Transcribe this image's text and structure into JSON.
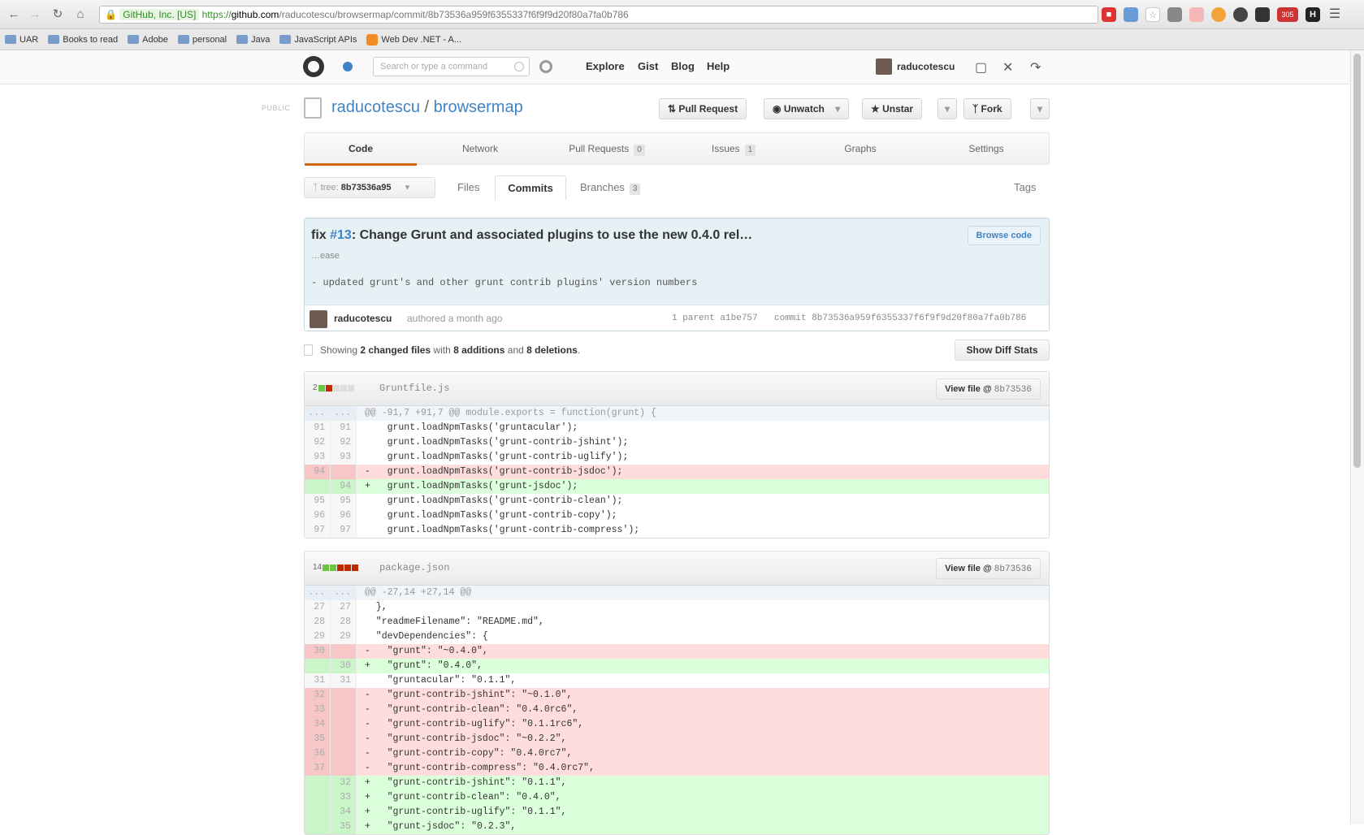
{
  "browser": {
    "address": {
      "org_label": "GitHub, Inc. [US]",
      "scheme": "https://",
      "host": "github.com",
      "path": "/raducotescu/browsermap/commit/8b73536a959f6355337f6f9f9d20f80a7fa0b786"
    },
    "bookmarks": [
      "UAR",
      "Books to read",
      "Adobe",
      "personal",
      "Java",
      "JavaScript APIs",
      "Web Dev .NET - A..."
    ],
    "ext_badge": "305"
  },
  "header": {
    "search_placeholder": "Search or type a command",
    "nav": [
      "Explore",
      "Gist",
      "Blog",
      "Help"
    ],
    "username": "raducotescu"
  },
  "repo": {
    "public_label": "PUBLIC",
    "owner": "raducotescu",
    "separator": "/",
    "name": "browsermap",
    "buttons": {
      "pull_request": "Pull Request",
      "unwatch": "Unwatch",
      "unstar": "Unstar",
      "fork": "Fork"
    }
  },
  "tabs": {
    "code": "Code",
    "network": "Network",
    "pull_requests": "Pull Requests",
    "pull_requests_count": "0",
    "issues": "Issues",
    "issues_count": "1",
    "graphs": "Graphs",
    "settings": "Settings"
  },
  "subnav": {
    "branch_prefix": "tree:",
    "branch": "8b73536a95",
    "files": "Files",
    "commits": "Commits",
    "branches": "Branches",
    "branches_count": "3",
    "tags": "Tags"
  },
  "commit": {
    "title_prefix": "fix ",
    "issue_ref": "#13",
    "title_rest": ": Change Grunt and associated plugins to use the new 0.4.0 rel…",
    "ellipsis": "…ease",
    "description": "- updated grunt's and other grunt contrib plugins' version numbers",
    "browse_code": "Browse code",
    "author": "raducotescu",
    "authored": "authored a month ago",
    "parent_info": "1 parent a1be757",
    "sha_line": "commit 8b73536a959f6355337f6f9f9d20f80a7fa0b786"
  },
  "toc": {
    "showing": "Showing ",
    "changed": "2 changed files",
    "with": " with ",
    "additions": "8 additions",
    "and": " and ",
    "deletions": "8 deletions",
    "end": ".",
    "diff_stats_btn": "Show Diff Stats"
  },
  "files": [
    {
      "name": "Gruntfile.js",
      "stat_count": "2",
      "view_label": "View file @",
      "view_sha": "8b73536",
      "rows": [
        {
          "type": "hunk",
          "old": "...",
          "new": "...",
          "text": "@@ -91,7 +91,7 @@ module.exports = function(grunt) {"
        },
        {
          "type": "ctx",
          "old": "91",
          "new": "91",
          "text": "    grunt.loadNpmTasks('gruntacular');"
        },
        {
          "type": "ctx",
          "old": "92",
          "new": "92",
          "text": "    grunt.loadNpmTasks('grunt-contrib-jshint');"
        },
        {
          "type": "ctx",
          "old": "93",
          "new": "93",
          "text": "    grunt.loadNpmTasks('grunt-contrib-uglify');"
        },
        {
          "type": "del",
          "old": "94",
          "new": "",
          "text": "-   grunt.loadNpmTasks('grunt-contrib-jsdoc');"
        },
        {
          "type": "add",
          "old": "",
          "new": "94",
          "text": "+   grunt.loadNpmTasks('grunt-jsdoc');"
        },
        {
          "type": "ctx",
          "old": "95",
          "new": "95",
          "text": "    grunt.loadNpmTasks('grunt-contrib-clean');"
        },
        {
          "type": "ctx",
          "old": "96",
          "new": "96",
          "text": "    grunt.loadNpmTasks('grunt-contrib-copy');"
        },
        {
          "type": "ctx",
          "old": "97",
          "new": "97",
          "text": "    grunt.loadNpmTasks('grunt-contrib-compress');"
        }
      ]
    },
    {
      "name": "package.json",
      "stat_count": "14",
      "view_label": "View file @",
      "view_sha": "8b73536",
      "rows": [
        {
          "type": "hunk",
          "old": "...",
          "new": "...",
          "text": "@@ -27,14 +27,14 @@"
        },
        {
          "type": "ctx",
          "old": "27",
          "new": "27",
          "text": "  },"
        },
        {
          "type": "ctx",
          "old": "28",
          "new": "28",
          "text": "  \"readmeFilename\": \"README.md\","
        },
        {
          "type": "ctx",
          "old": "29",
          "new": "29",
          "text": "  \"devDependencies\": {"
        },
        {
          "type": "del",
          "old": "30",
          "new": "",
          "text": "-   \"grunt\": \"~0.4.0\","
        },
        {
          "type": "add",
          "old": "",
          "new": "30",
          "text": "+   \"grunt\": \"0.4.0\","
        },
        {
          "type": "ctx",
          "old": "31",
          "new": "31",
          "text": "    \"gruntacular\": \"0.1.1\","
        },
        {
          "type": "del",
          "old": "32",
          "new": "",
          "text": "-   \"grunt-contrib-jshint\": \"~0.1.0\","
        },
        {
          "type": "del",
          "old": "33",
          "new": "",
          "text": "-   \"grunt-contrib-clean\": \"0.4.0rc6\","
        },
        {
          "type": "del",
          "old": "34",
          "new": "",
          "text": "-   \"grunt-contrib-uglify\": \"0.1.1rc6\","
        },
        {
          "type": "del",
          "old": "35",
          "new": "",
          "text": "-   \"grunt-contrib-jsdoc\": \"~0.2.2\","
        },
        {
          "type": "del",
          "old": "36",
          "new": "",
          "text": "-   \"grunt-contrib-copy\": \"0.4.0rc7\","
        },
        {
          "type": "del",
          "old": "37",
          "new": "",
          "text": "-   \"grunt-contrib-compress\": \"0.4.0rc7\","
        },
        {
          "type": "add",
          "old": "",
          "new": "32",
          "text": "+   \"grunt-contrib-jshint\": \"0.1.1\","
        },
        {
          "type": "add",
          "old": "",
          "new": "33",
          "text": "+   \"grunt-contrib-clean\": \"0.4.0\","
        },
        {
          "type": "add",
          "old": "",
          "new": "34",
          "text": "+   \"grunt-contrib-uglify\": \"0.1.1\","
        },
        {
          "type": "add",
          "old": "",
          "new": "35",
          "text": "+   \"grunt-jsdoc\": \"0.2.3\","
        }
      ]
    }
  ],
  "colors": {
    "link": "#4183c4",
    "addition_bg": "#dbffdb",
    "deletion_bg": "#ffdddd",
    "code_tab_accent": "#d26911"
  }
}
